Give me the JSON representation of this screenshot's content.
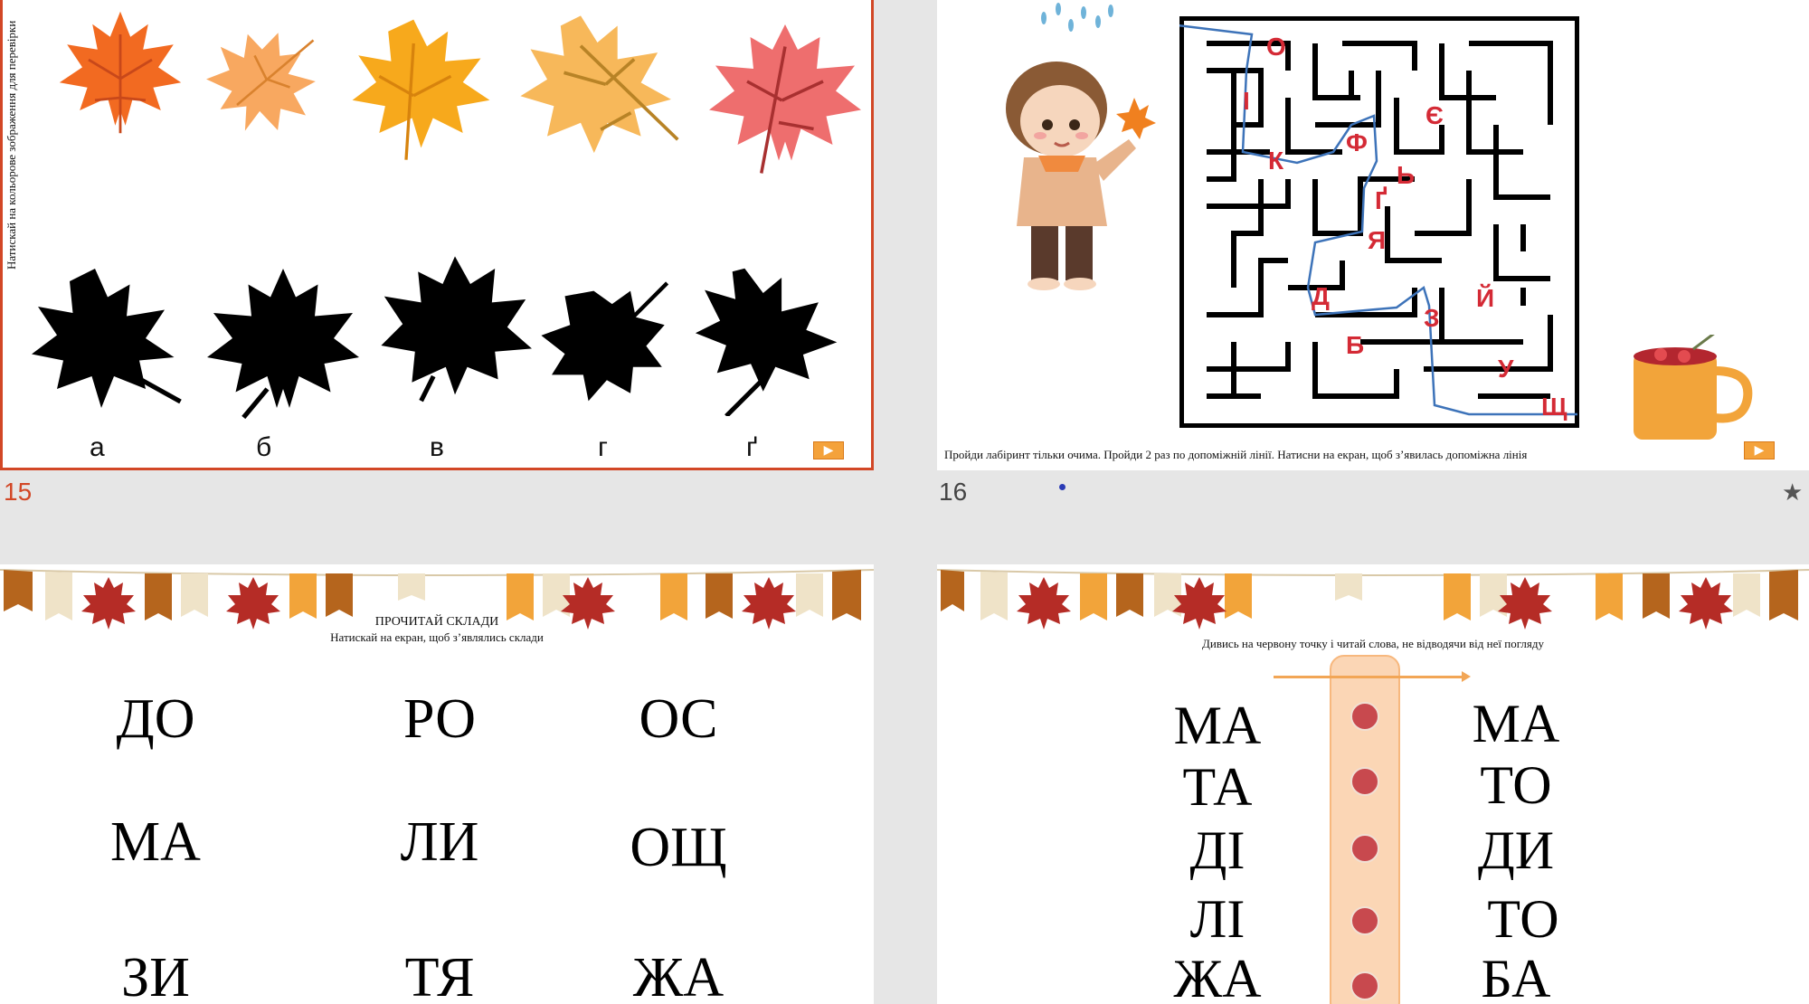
{
  "slides": [
    {
      "number": "15",
      "instruction_vertical": "Натискай на кольорове зображення для перевірки",
      "letters": [
        "а",
        "б",
        "в",
        "г",
        "ґ"
      ],
      "play_icon": "play-icon",
      "colors": {
        "border": "#d24726",
        "leaf_orange": "#f26a21",
        "leaf_peach": "#f8a860",
        "leaf_yellow": "#f7a91c",
        "leaf_light": "#f7b85a",
        "leaf_pink": "#ee6e6e",
        "silhouette": "#000000"
      }
    },
    {
      "number": "16",
      "instruction": "Пройди лабіринт тільки очима. Пройди 2 раз  по допоміжній лінії. Натисни на екран, щоб з’явилась допоміжна лінія",
      "maze_letters": [
        "О",
        "І",
        "К",
        "Ф",
        "Є",
        "Ь",
        "Ґ",
        "Я",
        "Д",
        "Б",
        "З",
        "Й",
        "У",
        "Щ"
      ],
      "play_icon": "play-icon",
      "star_icon": "star-icon"
    },
    {
      "title": "ПРОЧИТАЙ СКЛАДИ",
      "subtitle": "Натискай на екран, щоб з’являлись склади",
      "syllables": [
        "ДО",
        "РО",
        "ОС",
        "МА",
        "ЛИ",
        "ОЩ",
        "ЗИ",
        "ТЯ",
        "ЖА"
      ]
    },
    {
      "instruction": "Дивись на червону точку і читай слова, не відводячи від неї погляду",
      "left_words": [
        "МА",
        "ТА",
        "ДІ",
        "ЛІ",
        "ЖА"
      ],
      "right_words": [
        "МА",
        "ТО",
        "ДИ",
        "ТО",
        "БА"
      ],
      "colors": {
        "strip": "#fbd6b5",
        "dot": "#c8494e"
      }
    }
  ]
}
